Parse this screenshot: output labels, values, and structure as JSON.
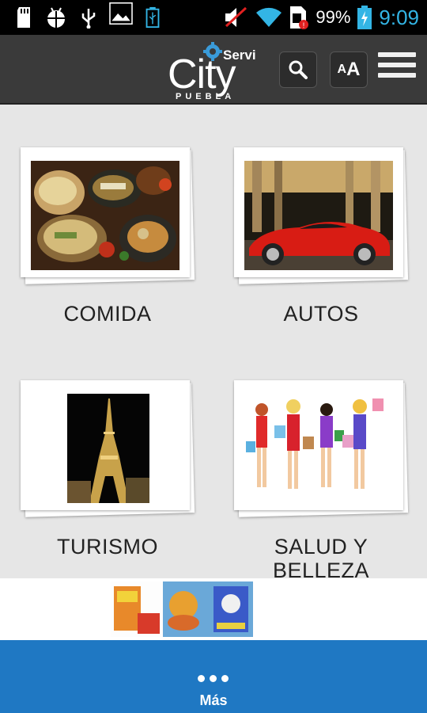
{
  "status_bar": {
    "battery_percent": "99%",
    "time": "9:09",
    "icons": [
      "sd-card-icon",
      "android-debug-icon",
      "usb-icon",
      "image-icon",
      "usb-battery-icon",
      "mute-icon",
      "wifi-icon",
      "sim-alert-icon",
      "battery-icon"
    ]
  },
  "header": {
    "logo_servi": "Servi",
    "logo_city": "City",
    "logo_puebla": "PUEBLA",
    "search_icon": "search-icon",
    "font_size_label_small": "A",
    "font_size_label_large": "A",
    "menu_icon": "hamburger-menu-icon"
  },
  "categories": [
    {
      "label": "COMIDA",
      "image": "food-photo"
    },
    {
      "label": "AUTOS",
      "image": "red-sports-car-photo"
    },
    {
      "label": "TURISMO",
      "image": "eiffel-tower-night-photo"
    },
    {
      "label": "SALUD Y BELLEZA",
      "image": "shopping-women-illustration"
    }
  ],
  "ad_banner": {
    "image": "snack-products-ad"
  },
  "more_bar": {
    "label": "Más"
  },
  "colors": {
    "status_time": "#33b5e5",
    "header_bg": "#3a3a3a",
    "content_bg": "#e6e6e6",
    "more_bar_bg": "#1f78c3"
  }
}
